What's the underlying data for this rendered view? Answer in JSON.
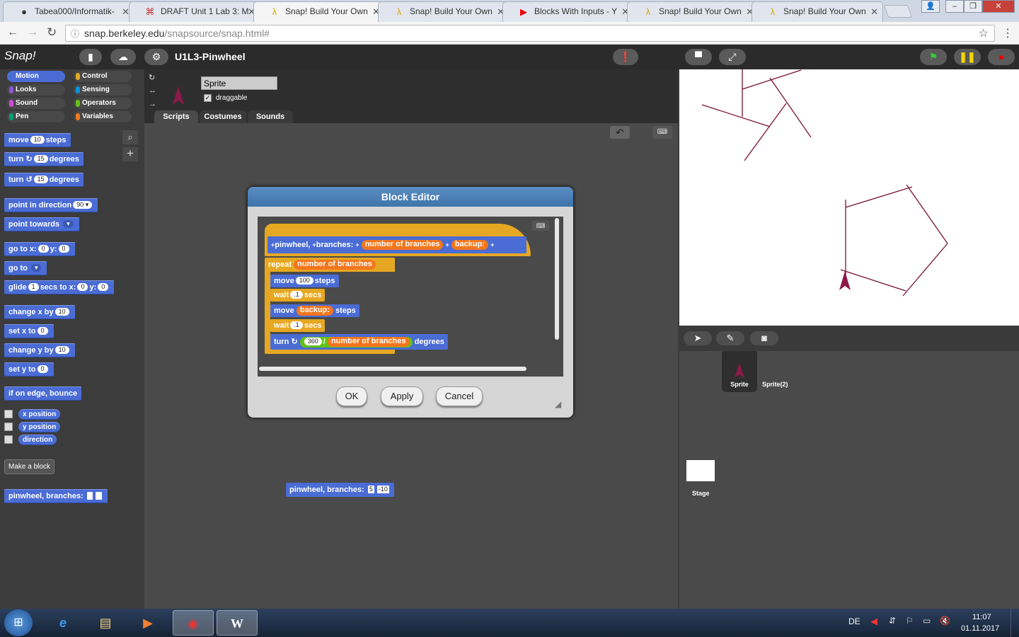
{
  "browser": {
    "tabs": [
      {
        "icon": "github-icon",
        "title": "Tabea000/Informatik-"
      },
      {
        "icon": "draft-icon",
        "title": "DRAFT Unit 1 Lab 3: M"
      },
      {
        "icon": "snap-lambda-icon",
        "title": "Snap! Build Your Own"
      },
      {
        "icon": "snap-lambda-icon",
        "title": "Snap! Build Your Own"
      },
      {
        "icon": "youtube-icon",
        "title": "Blocks With Inputs - Y"
      },
      {
        "icon": "snap-lambda-icon",
        "title": "Snap! Build Your Own"
      },
      {
        "icon": "snap-lambda-icon",
        "title": "Snap! Build Your Own"
      }
    ],
    "url_host": "snap.berkeley.edu",
    "url_path": "/snapsource/snap.html#"
  },
  "snap": {
    "logo": "Snap!",
    "project_title": "U1L3-Pinwheel",
    "categories": [
      "Motion",
      "Control",
      "Looks",
      "Sensing",
      "Sound",
      "Operators",
      "Pen",
      "Variables"
    ],
    "category_colors": [
      "#4a6cd4",
      "#e6a822",
      "#8a55d7",
      "#0494dc",
      "#cf4ad9",
      "#62c213",
      "#00a178",
      "#f3761d"
    ],
    "sprite_name": "Sprite",
    "draggable_label": "draggable",
    "editor_tabs": [
      "Scripts",
      "Costumes",
      "Sounds"
    ],
    "palette": {
      "move": [
        "move",
        "10",
        "steps"
      ],
      "turn_right": [
        "turn",
        "15",
        "degrees"
      ],
      "turn_left": [
        "turn",
        "15",
        "degrees"
      ],
      "point_dir": [
        "point in direction",
        "90"
      ],
      "point_towards": "point towards",
      "go_to_xy": [
        "go to x:",
        "0",
        "y:",
        "0"
      ],
      "go_to": "go to",
      "glide": [
        "glide",
        "1",
        "secs to x:",
        "0",
        "y:",
        "0"
      ],
      "change_x": [
        "change x by",
        "10"
      ],
      "set_x": [
        "set x to",
        "0"
      ],
      "change_y": [
        "change y by",
        "10"
      ],
      "set_y": [
        "set y to",
        "0"
      ],
      "bounce": "if on edge, bounce",
      "reporters": [
        "x position",
        "y position",
        "direction"
      ],
      "make_block": "Make a block",
      "custom": "pinwheel, branches:"
    },
    "script_block": {
      "label": "pinwheel, branches:",
      "arg1": "5",
      "arg2": "-10"
    },
    "dialog": {
      "title": "Block Editor",
      "hat": {
        "label1": "pinwheel,",
        "label2": "branches:",
        "param1": "number of branches",
        "param2": "backup:"
      },
      "repeat": {
        "label": "repeat",
        "var": "number of branches"
      },
      "move1": {
        "label": "move",
        "value": "100",
        "unit": "steps"
      },
      "wait1": {
        "label": "wait",
        "value": ".1",
        "unit": "secs"
      },
      "move2": {
        "label": "move",
        "var": "backup:",
        "unit": "steps"
      },
      "wait2": {
        "label": "wait",
        "value": ".1",
        "unit": "secs"
      },
      "turn": {
        "label": "turn",
        "value": "360",
        "op": "/",
        "var": "number of branches",
        "unit": "degrees"
      },
      "buttons": [
        "OK",
        "Apply",
        "Cancel"
      ]
    },
    "corral": {
      "sprites": [
        "Sprite",
        "Sprite(2)"
      ],
      "stage": "Stage"
    }
  },
  "taskbar": {
    "lang": "DE",
    "time": "11:07",
    "date": "01.11.2017"
  }
}
